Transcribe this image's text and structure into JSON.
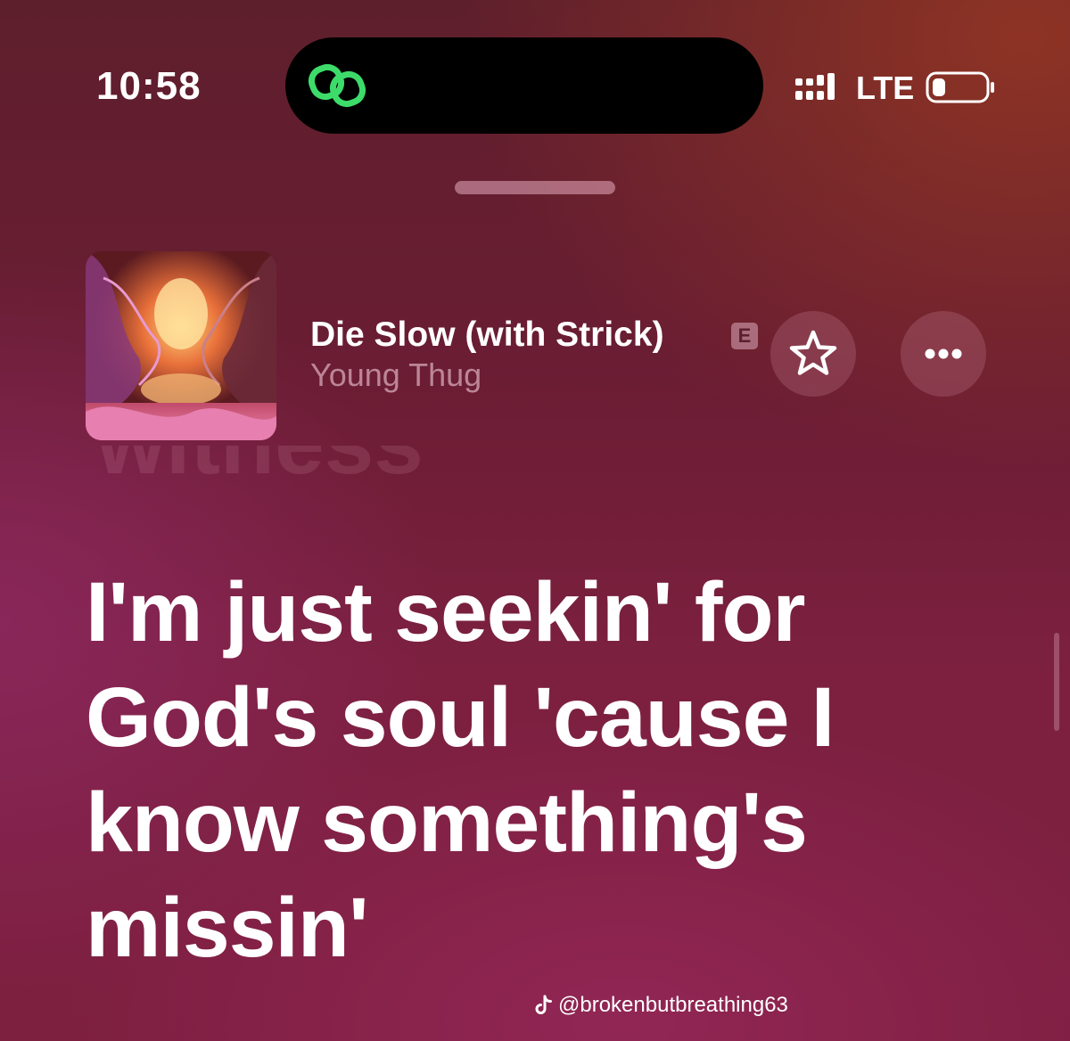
{
  "status_bar": {
    "time": "10:58",
    "network": "LTE",
    "island_icon": "link-icon",
    "signal_icon": "signal-bars-icon",
    "battery_icon": "battery-icon"
  },
  "now_playing": {
    "title": "Die Slow (with Strick)",
    "explicit_badge": "E",
    "artist": "Young Thug",
    "favorite_icon": "star-icon",
    "more_icon": "ellipsis-icon"
  },
  "lyrics": {
    "previous_line": "witness",
    "current_line": "I'm just seekin' for God's soul 'cause I know something's missin'"
  },
  "watermark": {
    "icon": "tiktok-icon",
    "handle": "@brokenbutbreathing63"
  },
  "colors": {
    "island_accent": "#3ddc6a",
    "background_top": "#5e1f2c",
    "background_bottom": "#7d1f3f"
  }
}
